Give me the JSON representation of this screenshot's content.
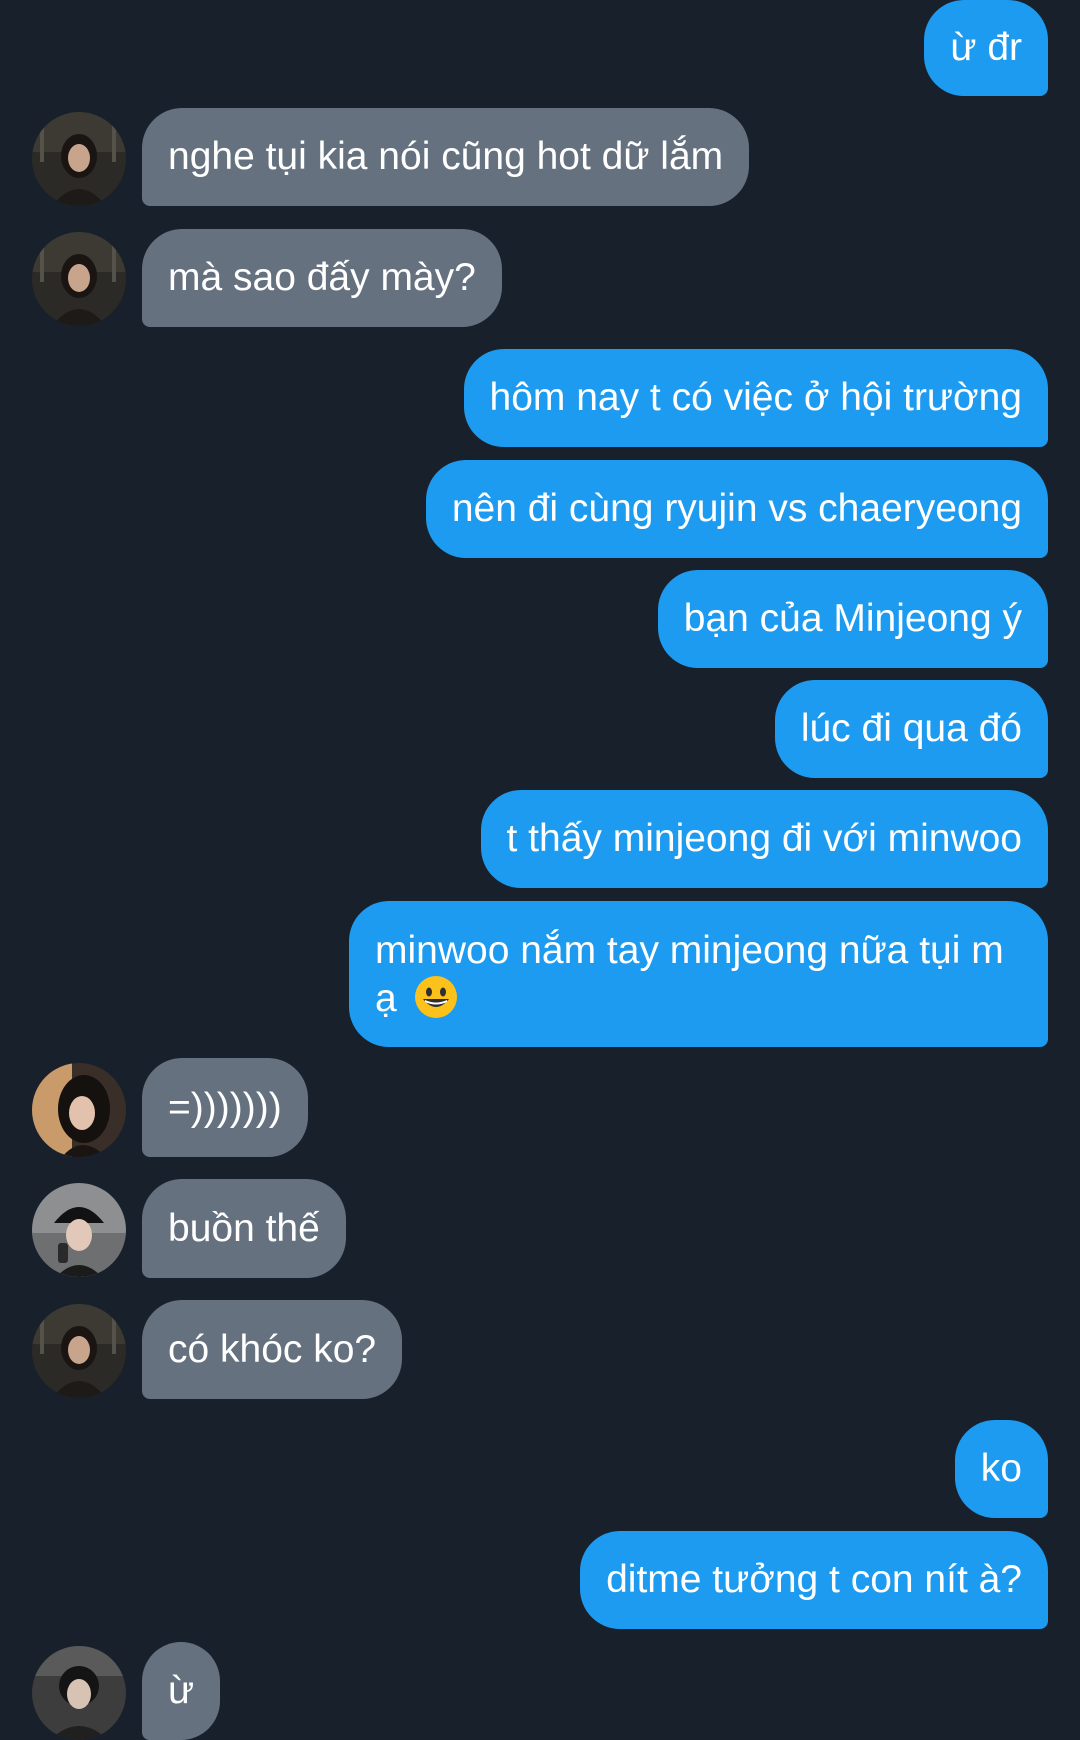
{
  "conversation": {
    "messages": [
      {
        "side": "out",
        "text": "ừ đr"
      },
      {
        "side": "in",
        "text": "nghe tụi kia nói cũng hot dữ lắm",
        "avatar": "avatar-a"
      },
      {
        "side": "in",
        "text": "mà sao đấy mày?",
        "avatar": "avatar-a"
      },
      {
        "side": "out",
        "text": "hôm nay t có việc ở hội trường"
      },
      {
        "side": "out",
        "text": "nên đi cùng ryujin vs chaeryeong"
      },
      {
        "side": "out",
        "text": "bạn của Minjeong ý"
      },
      {
        "side": "out",
        "text": "lúc đi qua đó"
      },
      {
        "side": "out",
        "text": "t thấy minjeong đi với minwoo"
      },
      {
        "side": "out",
        "text": "minwoo nắm tay minjeong nữa tụi m ạ",
        "emoji": "grinning-face-emoji"
      },
      {
        "side": "in",
        "text": "=)))))))",
        "avatar": "avatar-b"
      },
      {
        "side": "in",
        "text": "buồn thế",
        "avatar": "avatar-c"
      },
      {
        "side": "in",
        "text": "có khóc ko?",
        "avatar": "avatar-a"
      },
      {
        "side": "out",
        "text": "ko"
      },
      {
        "side": "out",
        "text": "ditme tưởng t con nít à?"
      },
      {
        "side": "in",
        "text": "ừ",
        "avatar": "avatar-d"
      }
    ]
  },
  "colors": {
    "background": "#18202b",
    "outgoing_bubble": "#1d9bf0",
    "incoming_bubble": "#65717f",
    "text": "#ffffff"
  }
}
